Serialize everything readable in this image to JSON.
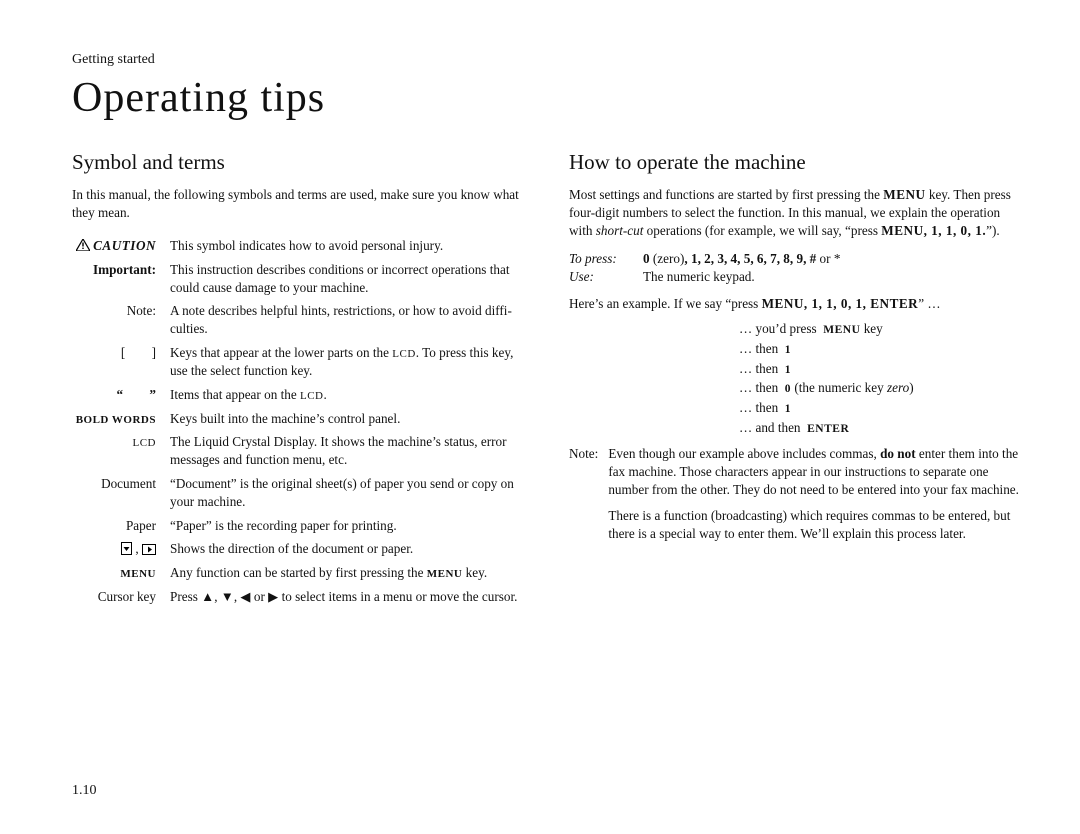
{
  "running_head": "Getting started",
  "title": "Operating tips",
  "left": {
    "heading": "Symbol and terms",
    "intro": "In this manual, the following symbols and terms are used, make sure you know what they mean.",
    "rows": [
      {
        "term": "CAUTION",
        "style": "caution",
        "desc": "This symbol indicates how to avoid personal injury."
      },
      {
        "term": "Important:",
        "style": "bold",
        "desc": "This instruction describes conditions or incorrect operations that could cause damage to your machine."
      },
      {
        "term": "Note:",
        "style": "plain",
        "desc_pre": "A note describes helpful hints, restrictions, or how to avoid diffi",
        "desc_post": "culties.",
        "hyphenated": true
      },
      {
        "term": "[  ]",
        "style": "plain",
        "desc": "Keys that appear at the lower parts on the LCD. To press this key, use the select function key.",
        "desc_sc": "LCD"
      },
      {
        "term": "“  ”",
        "style": "bold",
        "desc": "Items that appear on the LCD.",
        "desc_sc": "LCD"
      },
      {
        "term": "BOLD WORDS",
        "style": "boldcaps",
        "desc": "Keys built into the machine’s control panel."
      },
      {
        "term": "LCD",
        "style": "sc",
        "desc": "The Liquid Crystal Display. It shows the machine’s status, error messages and function menu, etc."
      },
      {
        "term": "Document",
        "style": "plain",
        "desc": "“Document” is the original sheet(s) of paper you send or copy on your machine."
      },
      {
        "term": "Paper",
        "style": "plain",
        "desc": "“Paper” is the recording paper for printing."
      },
      {
        "term": "PAGEICONS",
        "style": "pageicons",
        "desc": "Shows the direction of the document or paper."
      },
      {
        "term": "MENU",
        "style": "boldcaps",
        "desc": "Any function can be started by first pressing the MENU key.",
        "desc_bold": "MENU"
      },
      {
        "term": "Cursor key",
        "style": "plain",
        "desc": "Press ▲, ▼, ◀ or ▶ to select items in a menu or move the cursor."
      }
    ]
  },
  "right": {
    "heading": "How to operate the machine",
    "p1_a": "Most settings and functions are started by first pressing the ",
    "p1_menu": "MENU",
    "p1_b": " key. Then press four-digit numbers to select the function. In this manual, we explain the operation with ",
    "p1_i": "short-cut",
    "p1_c": " operations (for example, we will say, “press ",
    "p1_bold2": "MENU, 1, 1, 0, 1.",
    "p1_d": "”).",
    "press_label": "To press:",
    "press_val_a": "0",
    "press_val_b": " (zero)",
    "press_val_c": ", 1, 2, 3, 4, 5, 6, 7, 8, 9, #",
    "press_val_d": " or *",
    "use_label": "Use:",
    "use_val": "The numeric keypad.",
    "ex_a": "Here’s an example. If we say “press ",
    "ex_b": "MENU, 1, 1, 0, 1, ENTER",
    "ex_c": "” …",
    "steps": [
      {
        "a": "… you’d press",
        "b": "MENU",
        "c": " key"
      },
      {
        "a": "… then",
        "b": "1",
        "c": ""
      },
      {
        "a": "… then",
        "b": "1",
        "c": ""
      },
      {
        "a": "… then",
        "b": "0",
        "c": " (the numeric key ",
        "i": "zero",
        "c2": ")"
      },
      {
        "a": "… then",
        "b": "1",
        "c": ""
      },
      {
        "a": "… and then",
        "b": "ENTER",
        "c": ""
      }
    ],
    "note_label": "Note:",
    "note_p1_a": "Even though our example above includes commas, ",
    "note_p1_b": "do not",
    "note_p1_c": " enter them into the fax machine. Those characters appear in our instructions to separate one number from the other. They do not need to be entered into your fax machine.",
    "note_p2": "There is a function (broadcasting) which requires commas to be entered, but there is a special way to enter them. We’ll explain this process later."
  },
  "page_number": "1.10"
}
